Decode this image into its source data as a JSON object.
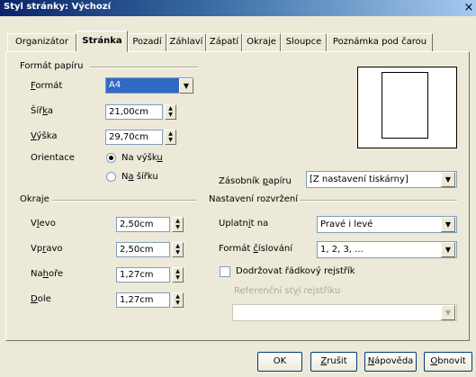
{
  "window": {
    "title": "Styl stránky: Výchozí",
    "close_glyph": "×"
  },
  "tabs": [
    {
      "label": "Organizátor"
    },
    {
      "label": "Stránka"
    },
    {
      "label": "Pozadí"
    },
    {
      "label": "Záhlaví"
    },
    {
      "label": "Zápatí"
    },
    {
      "label": "Okraje"
    },
    {
      "label": "Sloupce"
    },
    {
      "label": "Poznámka pod čarou"
    }
  ],
  "paper_format": {
    "title": "Formát papíru",
    "format": {
      "label_key": "F",
      "label_rest": "ormát",
      "value": "A4"
    },
    "width": {
      "label_pre": "Šíř",
      "label_key": "k",
      "label_post": "a",
      "value": "21,00cm"
    },
    "height": {
      "label_key": "V",
      "label_rest": "ýška",
      "value": "29,70cm"
    },
    "orientation": {
      "label": "Orientace",
      "portrait": {
        "label_pre": "Na výšk",
        "label_key": "u",
        "checked": true
      },
      "landscape": {
        "label_pre": "N",
        "label_key": "a",
        "label_post": " šířku",
        "checked": false
      }
    },
    "paper_tray": {
      "label_pre": "Zásobník ",
      "label_key": "p",
      "label_post": "apíru",
      "value": "[Z nastavení tiskárny]"
    }
  },
  "margins": {
    "title": "Okraje",
    "left": {
      "label_pre": "V",
      "label_key": "l",
      "label_post": "evo",
      "value": "2,50cm"
    },
    "right": {
      "label_pre": "Vp",
      "label_key": "r",
      "label_post": "avo",
      "value": "2,50cm"
    },
    "top": {
      "label_pre": "Na",
      "label_key": "h",
      "label_post": "oře",
      "value": "1,27cm"
    },
    "bottom": {
      "label_pre": "",
      "label_key": "D",
      "label_post": "ole",
      "value": "1,27cm"
    }
  },
  "layout": {
    "title": "Nastavení rozvržení",
    "apply_to": {
      "label_pre": "Uplatn",
      "label_key": "i",
      "label_post": "t na",
      "value": "Pravé i levé"
    },
    "numbering": {
      "label_pre": "Formát ",
      "label_key": "č",
      "label_post": "íslování",
      "value": "1, 2, 3, ..."
    },
    "register": {
      "label": "Dodržovat řádkový rejstřík",
      "checked": false
    },
    "ref_style": {
      "label_pre": "Referenční st",
      "label_key": "y",
      "label_post": "l rejstříku",
      "value": ""
    }
  },
  "buttons": {
    "ok": "OK",
    "cancel_key": "Z",
    "cancel_rest": "rušit",
    "help_key": "N",
    "help_rest": "ápověda",
    "reset_key": "O",
    "reset_rest": "bnovit"
  },
  "icons": {
    "dropdown": "▼",
    "spin_up": "▲",
    "spin_down": "▼"
  }
}
